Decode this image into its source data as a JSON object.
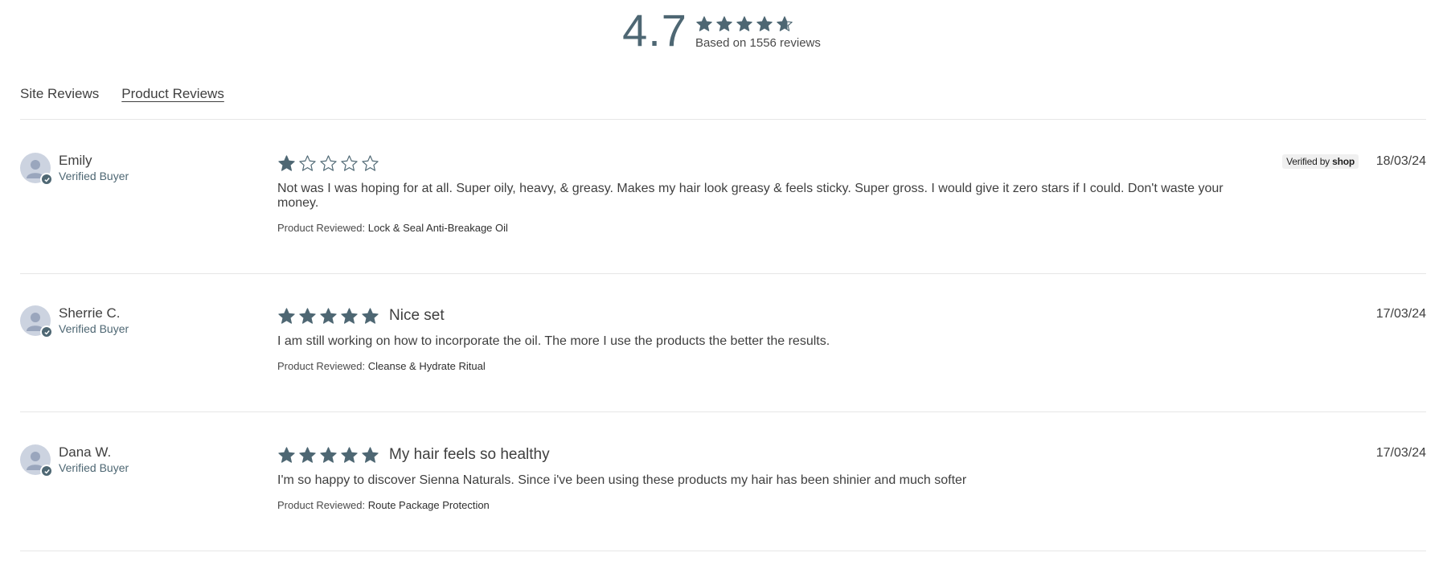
{
  "summary": {
    "average": "4.7",
    "rating_value": 4.7,
    "based_on": "Based on 1556 reviews",
    "star_color": "#4e6773"
  },
  "tabs": [
    {
      "label": "Site Reviews",
      "active": false
    },
    {
      "label": "Product Reviews",
      "active": true
    }
  ],
  "reviews": [
    {
      "name": "Emily",
      "badge": "Verified Buyer",
      "rating": 1,
      "title": "",
      "text": "Not was I was hoping for at all. Super oily, heavy, & greasy. Makes my hair look greasy & feels sticky. Super gross. I would give it zero stars if I could. Don't waste your money.",
      "product_prefix": "Product Reviewed:",
      "product": "Lock & Seal Anti-Breakage Oil",
      "date": "18/03/24",
      "verified_by": "Verified by",
      "verified_brand": "shop"
    },
    {
      "name": "Sherrie C.",
      "badge": "Verified Buyer",
      "rating": 5,
      "title": "Nice set",
      "text": "I am still working on how to incorporate the oil. The more I use the products the better the results.",
      "product_prefix": "Product Reviewed:",
      "product": "Cleanse & Hydrate Ritual",
      "date": "17/03/24"
    },
    {
      "name": "Dana W.",
      "badge": "Verified Buyer",
      "rating": 5,
      "title": "My hair feels so healthy",
      "text": "I'm so happy to discover Sienna Naturals. Since i've been using these products my hair has been shinier and much softer",
      "product_prefix": "Product Reviewed:",
      "product": "Route Package Protection",
      "date": "17/03/24"
    }
  ]
}
